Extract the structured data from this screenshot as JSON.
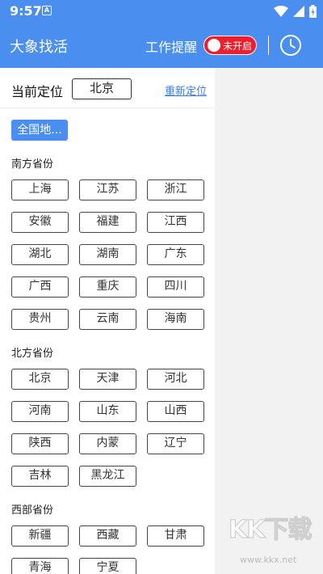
{
  "status": {
    "time": "9:57",
    "notif_glyph": "A"
  },
  "appbar": {
    "title": "大象找活",
    "remind_label": "工作提醒",
    "remind_state": "未开启"
  },
  "location": {
    "label": "当前定位",
    "value": "北京",
    "relocate": "重新定位"
  },
  "all_regions": "全国地...",
  "sections": [
    {
      "title": "南方省份",
      "items": [
        "上海",
        "江苏",
        "浙江",
        "安徽",
        "福建",
        "江西",
        "湖北",
        "湖南",
        "广东",
        "广西",
        "重庆",
        "四川",
        "贵州",
        "云南",
        "海南"
      ]
    },
    {
      "title": "北方省份",
      "items": [
        "北京",
        "天津",
        "河北",
        "河南",
        "山东",
        "山西",
        "陕西",
        "内蒙",
        "辽宁",
        "吉林",
        "黑龙江"
      ]
    },
    {
      "title": "西部省份",
      "items": [
        "新疆",
        "西藏",
        "甘肃",
        "青海",
        "宁夏"
      ]
    }
  ],
  "watermark": {
    "text": "KK下载",
    "url": "www.kkx.net"
  },
  "colors": {
    "primary": "#4a8ef0",
    "toggle_off": "#f01e2c",
    "link": "#3d7fe8"
  }
}
